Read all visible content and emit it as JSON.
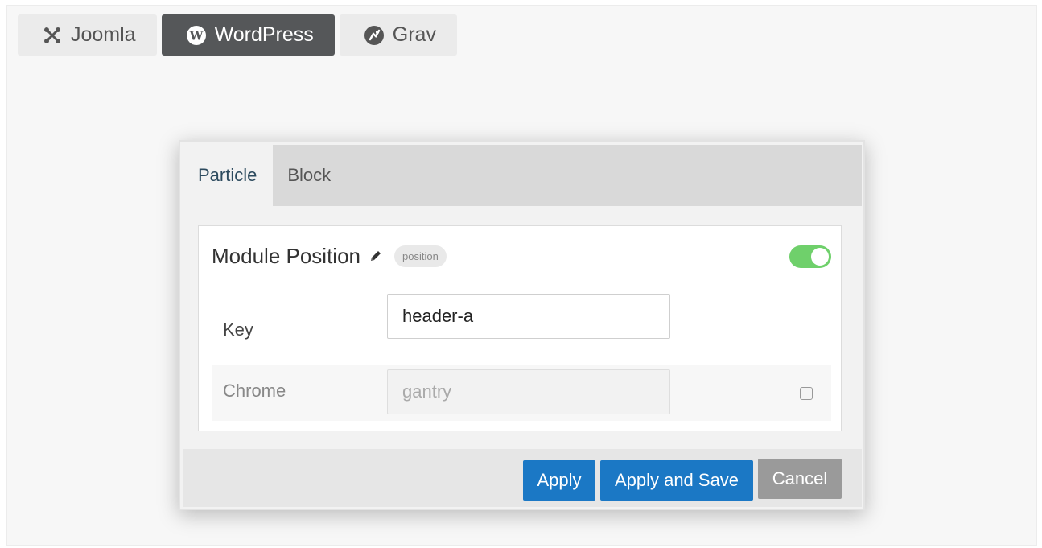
{
  "platform_tabs": [
    {
      "label": "Joomla",
      "icon": "joomla-icon",
      "active": false
    },
    {
      "label": "WordPress",
      "icon": "wordpress-icon",
      "active": true
    },
    {
      "label": "Grav",
      "icon": "grav-icon",
      "active": false
    }
  ],
  "modal": {
    "tabs": [
      {
        "label": "Particle",
        "active": true
      },
      {
        "label": "Block",
        "active": false
      }
    ],
    "panel": {
      "title": "Module Position",
      "badge": "position",
      "toggle_on": true
    },
    "fields": {
      "key": {
        "label": "Key",
        "value": "header-a"
      },
      "chrome": {
        "label": "Chrome",
        "value": "gantry",
        "disabled": true,
        "override_checked": false
      }
    },
    "buttons": {
      "apply": "Apply",
      "apply_save": "Apply and Save",
      "cancel": "Cancel"
    }
  },
  "colors": {
    "primary_button": "#1b78c5",
    "toggle_on": "#6fd06b",
    "active_platform_tab": "#555759",
    "cancel_button": "#9a9a9a"
  }
}
